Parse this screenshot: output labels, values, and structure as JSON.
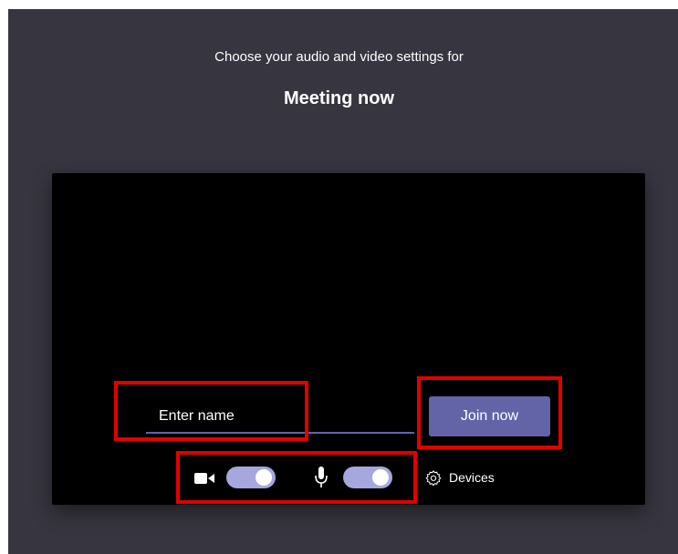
{
  "header": {
    "subtitle": "Choose your audio and video settings for",
    "meeting_title": "Meeting now"
  },
  "name_input": {
    "placeholder": "Enter name",
    "value": ""
  },
  "join_button": {
    "label": "Join now"
  },
  "controls": {
    "camera": {
      "icon": "camera-icon",
      "on": true
    },
    "microphone": {
      "icon": "microphone-icon",
      "on": true
    },
    "devices": {
      "icon": "gear-icon",
      "label": "Devices"
    }
  },
  "colors": {
    "background": "#37353f",
    "preview": "#000000",
    "accent": "#6264a7",
    "toggle_track": "#a6a7dc",
    "highlight": "#e00000"
  }
}
